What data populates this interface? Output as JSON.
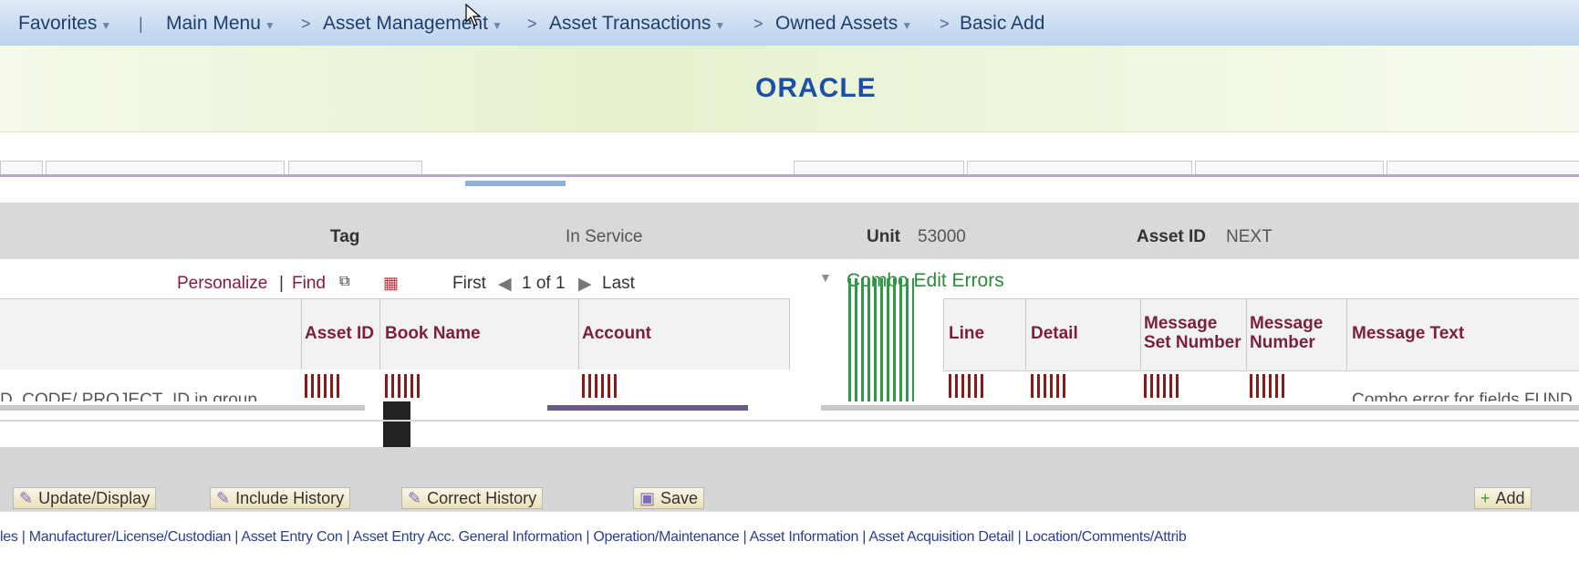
{
  "breadcrumb": {
    "items": [
      "Favorites",
      "Main Menu",
      "Asset Management",
      "Asset Transactions",
      "Owned Assets",
      "Basic Add"
    ],
    "separator": ">"
  },
  "banner": {
    "logo_text": "ORACLE"
  },
  "header": {
    "tag_label": "Tag",
    "in_service_label": "In Service",
    "unit_label": "Unit",
    "unit_value": "53000",
    "asset_id_label": "Asset ID",
    "asset_id_value": "NEXT"
  },
  "left_grid": {
    "nav": {
      "personalize": "Personalize",
      "find": "Find",
      "first": "First",
      "count": "1 of 1",
      "last": "Last"
    },
    "columns": [
      "Asset ID",
      "Book Name",
      "Account"
    ],
    "row_text": "D_CODE/ PROJECT_ID in group"
  },
  "combo_panel": {
    "title": "Combo Edit Errors",
    "columns": [
      "Line",
      "Detail",
      "Message Set Number",
      "Message Number",
      "Message Text"
    ],
    "row_message": "Combo error for fields FUND"
  },
  "toolbar": {
    "update_display": "Update/Display",
    "include_history": "Include History",
    "correct_history": "Correct History",
    "save": "Save",
    "add": "Add"
  },
  "footer": {
    "links_text": "les | Manufacturer/License/Custodian | Asset Entry Con | Asset Entry Acc. General Information | Operation/Maintenance | Asset Information | Asset Acquisition Detail | Location/Comments/Attrib"
  },
  "colors": {
    "link": "#8b1a3a",
    "green": "#2c8a3a",
    "oracle_blue": "#1d4fa8"
  }
}
